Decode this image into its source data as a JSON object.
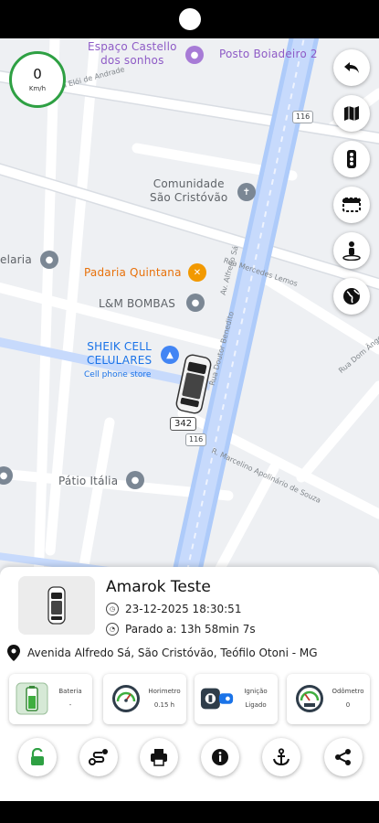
{
  "speed": {
    "value": "0",
    "unit": "Km/h"
  },
  "map": {
    "pois": [
      {
        "name": "Espaço Castello\ndos sonhos",
        "color": "purple"
      },
      {
        "name": "Posto Boiadeiro 2",
        "color": "purple"
      },
      {
        "name": "Comunidade\nSão Cristóvão",
        "color": "gray"
      },
      {
        "name": "elaria",
        "color": "gray"
      },
      {
        "name": "Padaria Quintana",
        "color": "orange"
      },
      {
        "name": "L&M BOMBAS",
        "color": "gray"
      },
      {
        "name": "SHEIK CELL\nCELULARES",
        "color": "blue",
        "sub": "Cell phone store"
      },
      {
        "name": "Pátio Itália",
        "color": "gray"
      }
    ],
    "streets": [
      "Rua Mercedes Lemos",
      "Av. Alfredo Sá",
      "Rua Doutor Benedito",
      "R. Marcelino Apolinário de Souza",
      "Rua Elói de Andrade",
      "Rua Dom Ângelo"
    ],
    "shields": [
      "116",
      "116",
      "342"
    ]
  },
  "map_buttons": [
    {
      "icon": "undo-arrow-icon"
    },
    {
      "icon": "map-icon"
    },
    {
      "icon": "traffic-light-icon"
    },
    {
      "icon": "layers-icon"
    },
    {
      "icon": "street-view-icon"
    },
    {
      "icon": "globe-icon"
    }
  ],
  "vehicle": {
    "name": "Amarok Teste",
    "datetime": "23-12-2025 18:30:51",
    "stopped": "Parado a: 13h 58min 7s",
    "address": "Avenida Alfredo Sá, São Cristóvão, Teófilo Otoni - MG",
    "plate": "342"
  },
  "status_cards": [
    {
      "label": "Bateria",
      "value": "-",
      "icon": "battery-icon"
    },
    {
      "label": "Horimetro",
      "value": "0.15 h",
      "icon": "gauge-icon"
    },
    {
      "label": "Ignição",
      "value": "Ligado",
      "icon": "ignition-key-icon"
    },
    {
      "label": "Odômetro",
      "value": "0",
      "icon": "odometer-icon"
    }
  ],
  "actions": [
    {
      "icon": "unlock-icon"
    },
    {
      "icon": "route-icon"
    },
    {
      "icon": "printer-icon"
    },
    {
      "icon": "info-icon"
    },
    {
      "icon": "anchor-icon"
    },
    {
      "icon": "share-icon"
    }
  ],
  "colors": {
    "accent_green": "#2ea043",
    "map_bg": "#eef0f3",
    "road": "#ffffff",
    "avenue": "#aecbfa"
  }
}
